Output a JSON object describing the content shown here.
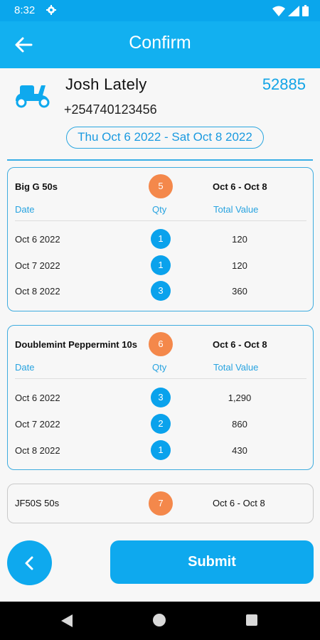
{
  "status_bar": {
    "time": "8:32",
    "settings_icon": "gear-icon",
    "icons": [
      "wifi-icon",
      "signal-icon",
      "battery-icon"
    ]
  },
  "app_bar": {
    "title": "Confirm",
    "back_icon": "arrow-left-icon"
  },
  "customer": {
    "name": "Josh Lately",
    "phone": "+254740123456",
    "order_number": "52885",
    "date_range": "Thu Oct 6 2022 - Sat Oct 8 2022",
    "icon": "scooter-icon"
  },
  "columns": {
    "date": "Date",
    "qty": "Qty",
    "total_value": "Total Value"
  },
  "products": [
    {
      "name": "Big G 50s",
      "count": "5",
      "range": "Oct 6 - Oct 8",
      "rows": [
        {
          "date": "Oct 6 2022",
          "qty": "1",
          "value": "120"
        },
        {
          "date": "Oct 7 2022",
          "qty": "1",
          "value": "120"
        },
        {
          "date": "Oct 8 2022",
          "qty": "3",
          "value": "360"
        }
      ]
    },
    {
      "name": "Doublemint Peppermint 10s",
      "count": "6",
      "range": "Oct 6 - Oct 8",
      "rows": [
        {
          "date": "Oct 6 2022",
          "qty": "3",
          "value": "1,290"
        },
        {
          "date": "Oct 7 2022",
          "qty": "2",
          "value": "860"
        },
        {
          "date": "Oct 8 2022",
          "qty": "1",
          "value": "430"
        }
      ]
    },
    {
      "name": "JF50S 50s",
      "count": "7",
      "range": "Oct 6 - Oct 8",
      "rows": []
    }
  ],
  "actions": {
    "submit_label": "Submit",
    "back_icon": "chevron-left-icon"
  },
  "colors": {
    "primary": "#0EA9EE",
    "accent": "#F4884B",
    "background": "#F7F7F7"
  }
}
